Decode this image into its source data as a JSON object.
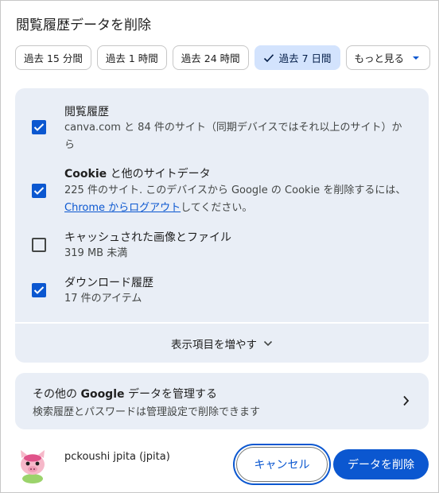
{
  "dialog": {
    "title": "閲覧履歴データを削除"
  },
  "time_range": {
    "chips": [
      {
        "label": "過去 15 分間",
        "selected": false
      },
      {
        "label": "過去 1 時間",
        "selected": false
      },
      {
        "label": "過去 24 時間",
        "selected": false
      },
      {
        "label": "過去 7 日間",
        "selected": true
      }
    ],
    "more_label": "もっと見る"
  },
  "items": [
    {
      "title": "閲覧履歴",
      "desc": "canva.com と 84 件のサイト（同期デバイスではそれ以上のサイト）から",
      "checked": true
    },
    {
      "title_bold": "Cookie",
      "title_rest": " と他のサイトデータ",
      "desc_part1": "225 件のサイト. このデバイスから Google の Cookie を削除するには、",
      "desc_link": "Chrome からログアウト",
      "desc_part2": "してください。",
      "checked": true
    },
    {
      "title": "キャッシュされた画像とファイル",
      "desc": "319 MB 未満",
      "checked": false
    },
    {
      "title": "ダウンロード履歴",
      "desc": "17 件のアイテム",
      "checked": true
    }
  ],
  "more_items_label": "表示項目を増やす",
  "manage": {
    "title_pre": "その他の ",
    "title_bold": "Google",
    "title_post": " データを管理する",
    "desc": "検索履歴とパスワードは管理設定で削除できます"
  },
  "account": {
    "name": "pckoushi jpita (jpita)"
  },
  "buttons": {
    "cancel": "キャンセル",
    "delete": "データを削除"
  },
  "colors": {
    "accent": "#0b57d0",
    "panel_bg": "#e9eef6",
    "selected_chip": "#d3e3fd"
  },
  "icons": [
    "check-icon",
    "caret-down-icon",
    "chevron-down-icon",
    "chevron-right-icon",
    "checkbox-check-icon"
  ]
}
